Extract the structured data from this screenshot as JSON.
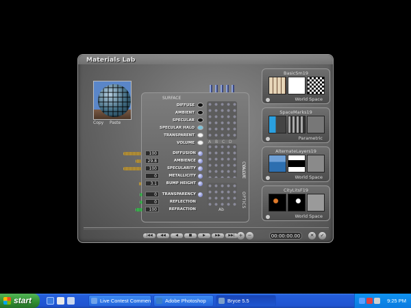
{
  "window": {
    "title": "Materials Lab",
    "preview_labels": [
      "Copy",
      "Paste"
    ]
  },
  "channels": {
    "surface_label": "SURFACE",
    "rows": [
      "DIFFUSE",
      "AMBIENT",
      "SPECULAR",
      "SPECULAR HALO",
      "TRANSPARENT",
      "VOLUME"
    ],
    "swatch_colors": [
      "#111111",
      "#111111",
      "#111111",
      "#7cc1d8",
      "#f2f2f2",
      "#f2f2f2"
    ],
    "abcd": [
      "A",
      "B",
      "C",
      "D"
    ],
    "group_color": "COLOR"
  },
  "values": {
    "group_label": "VALUE",
    "rows": [
      {
        "num": "100",
        "label": "DIFFUSION"
      },
      {
        "num": "29.8",
        "label": "AMBIENCE"
      },
      {
        "num": "100",
        "label": "SPECULARITY"
      },
      {
        "num": "0",
        "label": "METALLICITY"
      },
      {
        "num": "3.1",
        "label": "BUMP HEIGHT"
      }
    ]
  },
  "optics": {
    "group_label": "OPTICS",
    "rows": [
      {
        "num": "0",
        "label": "TRANSPARENCY"
      },
      {
        "num": "0",
        "label": "REFLECTION"
      },
      {
        "num": "100",
        "label": "REFRACTION"
      }
    ],
    "extra": "Ab"
  },
  "library": [
    {
      "name": "BasicSm19",
      "space": "World Space"
    },
    {
      "name": "SpaceMarks19",
      "space": "Parametric"
    },
    {
      "name": "AlternateLayers19",
      "space": "World Space"
    },
    {
      "name": "CityLitsF19",
      "space": "World Space"
    }
  ],
  "transport": {
    "time": "00:00:00.00",
    "buttons": [
      "|◀◀",
      "◀◀",
      "◀",
      "■",
      "▶",
      "▶▶",
      "▶▶|"
    ]
  },
  "taskbar": {
    "start_label": "start",
    "tasks": [
      "Live Contest Commen...",
      "Adobe Photoshop",
      "Bryce 5.5"
    ],
    "clock": "9:25 PM"
  }
}
